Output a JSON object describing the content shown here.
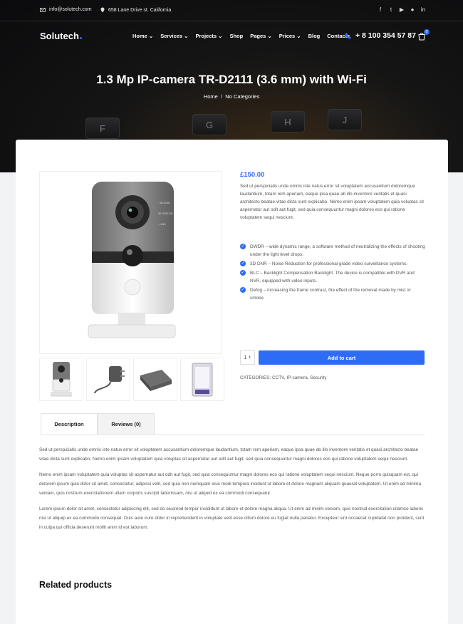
{
  "topbar": {
    "email": "info@solutech.com",
    "address": "658 Lane Drive st. California",
    "social_icons": [
      "facebook-icon",
      "twitter-icon",
      "youtube-icon",
      "github-icon",
      "linkedin-icon"
    ]
  },
  "nav": {
    "logo": "Solutech",
    "menu": [
      "Home",
      "Services",
      "Projects",
      "Shop",
      "Pages",
      "Prices",
      "Blog",
      "Contacts"
    ],
    "phone": "+ 8 100 354 57 87",
    "cart_count": "0"
  },
  "hero": {
    "title": "1.3 Mp IP-camera TR-D2111 (3.6 mm) with Wi-Fi",
    "breadcrumb": [
      "Home",
      "No Categories"
    ],
    "breadcrumb_sep": "/",
    "keyboard_keys": [
      "F",
      "G",
      "H",
      "J"
    ]
  },
  "product": {
    "price": "£150.00",
    "short_description": "Sed ut perspiciatis unde omnis iste natus error sit voluptatem accusantium doloremque laudantium, totam rem aperiam, eaque ipsa quae ab illo inventore veritatis et quasi architecto beatae vitae dicta sunt explicabo. Nemo enim ipsam voluptatem quia voluptas sit aspernatur aut odit aut fugit, sed quia consequuntur magni dolores eos qui ratione voluptatem sequi nesciunt.",
    "features": [
      "DWDR – wide dynamic range, a software method of neutralizing the effects of shooting under the light level drops.",
      "3D DNR – Noise Reduction for professional grade video surveillance systems.",
      "BLC – Backlight Compensation Backlight. The device is compatible with DVR and NVR, equipped with video inputs.",
      "Defog – increasing the frame contrast, the effect of the removal made by mist or smoke."
    ],
    "quantity": "1",
    "add_to_cart": "Add to cart",
    "categories": "CATEGORIES: CCTV, IP-camera, Security",
    "camera_labels": [
      "Wi-LINK",
      "IR STATUS",
      "LINK"
    ]
  },
  "tabs": [
    "Description",
    "Reviews (0)"
  ],
  "description": [
    "Sed ut perspiciatis unde omnis iste natus error sit voluptatem accusantium doloremque laudantium, totam rem aperiam, eaque ipsa quae ab illo inventore veritatis et quasi architecto beatae vitae dicta sunt explicabo. Nemo enim ipsam voluptatem quia voluptas sit aspernatur aut odit aut fugit, sed quia consequuntur magni dolores eos qui ratione voluptatem sequi nesciunt.",
    "Nemo enim ipsam voluptatem quia voluptas sit aspernatur aut odit aut fugit, sed quia consequuntur magni dolores eos qui ratione voluptatem sequi nesciunt. Neque porro quisquam est, qui dolorem ipsum quia dolor sit amet, consectetur, adipisci velit, sed quia non numquam eius modi tempora incidunt ut labore et dolore magnam aliquam quaerat voluptatem. Ut enim ad minima veniam, quis nostrum exercitationem ullam corporis suscipit laboriosam, nisi ut aliquid ex ea commodi consequatur.",
    "Lorem ipsum dolor sit amet, consectetur adipiscing elit, sed do eiusmod tempor incididunt ut labore et dolore magna aliqua. Ut enim ad minim veniam, quis nostrud exercitation ullamco laboris nisi ut aliquip ex ea commodo consequat. Duis aute irure dolor in reprehenderit in voluptate velit esse cillum dolore eu fugiat nulla pariatur. Excepteur sint occaecat cupidatat non proident, sunt in culpa qui officia deserunt mollit anim id est laborum."
  ],
  "related_title": "Related products",
  "colors": {
    "accent": "#2f6cf6",
    "dark": "#111111"
  }
}
